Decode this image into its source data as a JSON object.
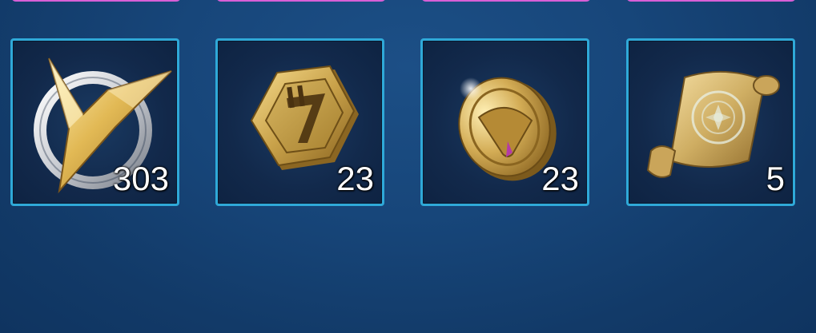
{
  "colors": {
    "background": "#17467a",
    "slot_border": "#2fa9d8",
    "top_bar_border": "#d85fd6",
    "count_text": "#ffffff"
  },
  "items": [
    {
      "icon": "v-emblem-icon",
      "count": "303"
    },
    {
      "icon": "hexagon-coin-7-icon",
      "count": "23"
    },
    {
      "icon": "gold-coin-icon",
      "count": "23"
    },
    {
      "icon": "scroll-icon",
      "count": "5"
    }
  ]
}
